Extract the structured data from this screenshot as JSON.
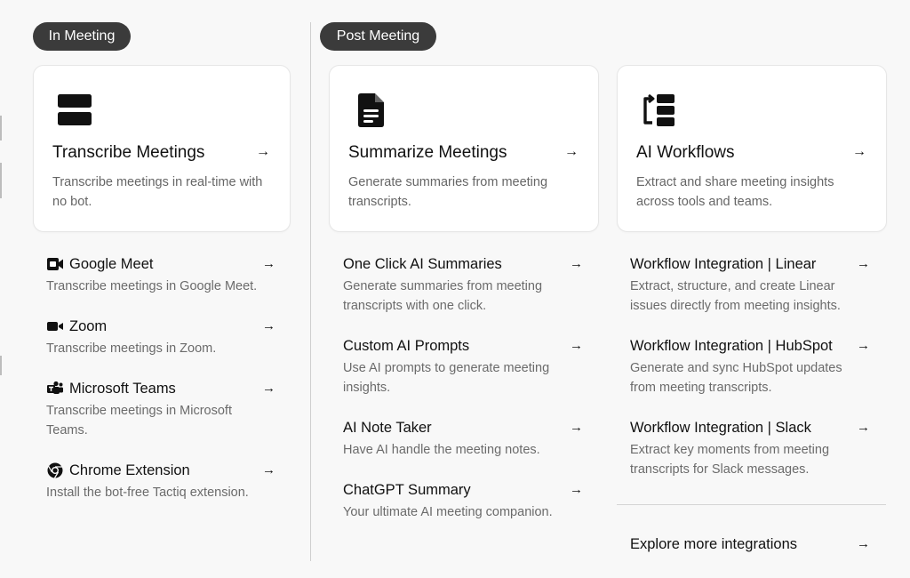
{
  "sections": {
    "in_meeting": "In Meeting",
    "post_meeting": "Post Meeting"
  },
  "cards": {
    "transcribe": {
      "title": "Transcribe Meetings",
      "description": "Transcribe meetings in real-time with no bot.",
      "icon": "transcript-icon"
    },
    "summarize": {
      "title": "Summarize Meetings",
      "description": "Generate summaries from meeting transcripts.",
      "icon": "document-icon"
    },
    "workflows": {
      "title": "AI Workflows",
      "description": "Extract and share meeting insights across tools and teams.",
      "icon": "workflow-icon"
    }
  },
  "in_meeting_items": [
    {
      "title": "Google Meet",
      "description": "Transcribe meetings in Google Meet.",
      "icon": "google-meet-icon"
    },
    {
      "title": "Zoom",
      "description": "Transcribe meetings in Zoom.",
      "icon": "zoom-icon"
    },
    {
      "title": "Microsoft Teams",
      "description": "Transcribe meetings in Microsoft Teams.",
      "icon": "microsoft-teams-icon"
    },
    {
      "title": "Chrome Extension",
      "description": "Install the bot-free Tactiq extension.",
      "icon": "chrome-icon"
    }
  ],
  "summary_items": [
    {
      "title": "One Click AI Summaries",
      "description": "Generate summaries from meeting transcripts with one click."
    },
    {
      "title": "Custom AI Prompts",
      "description": "Use AI prompts to generate meeting insights."
    },
    {
      "title": "AI Note Taker",
      "description": "Have AI handle the meeting notes."
    },
    {
      "title": "ChatGPT Summary",
      "description": "Your ultimate AI meeting companion."
    }
  ],
  "workflow_items": [
    {
      "title": "Workflow Integration | Linear",
      "description": "Extract, structure, and create Linear issues directly from meeting insights."
    },
    {
      "title": "Workflow Integration | HubSpot",
      "description": "Generate and sync HubSpot updates from meeting transcripts."
    },
    {
      "title": "Workflow Integration | Slack",
      "description": "Extract key moments from meeting transcripts for Slack messages."
    }
  ],
  "explore": {
    "label": "Explore more integrations"
  },
  "arrow": "→"
}
